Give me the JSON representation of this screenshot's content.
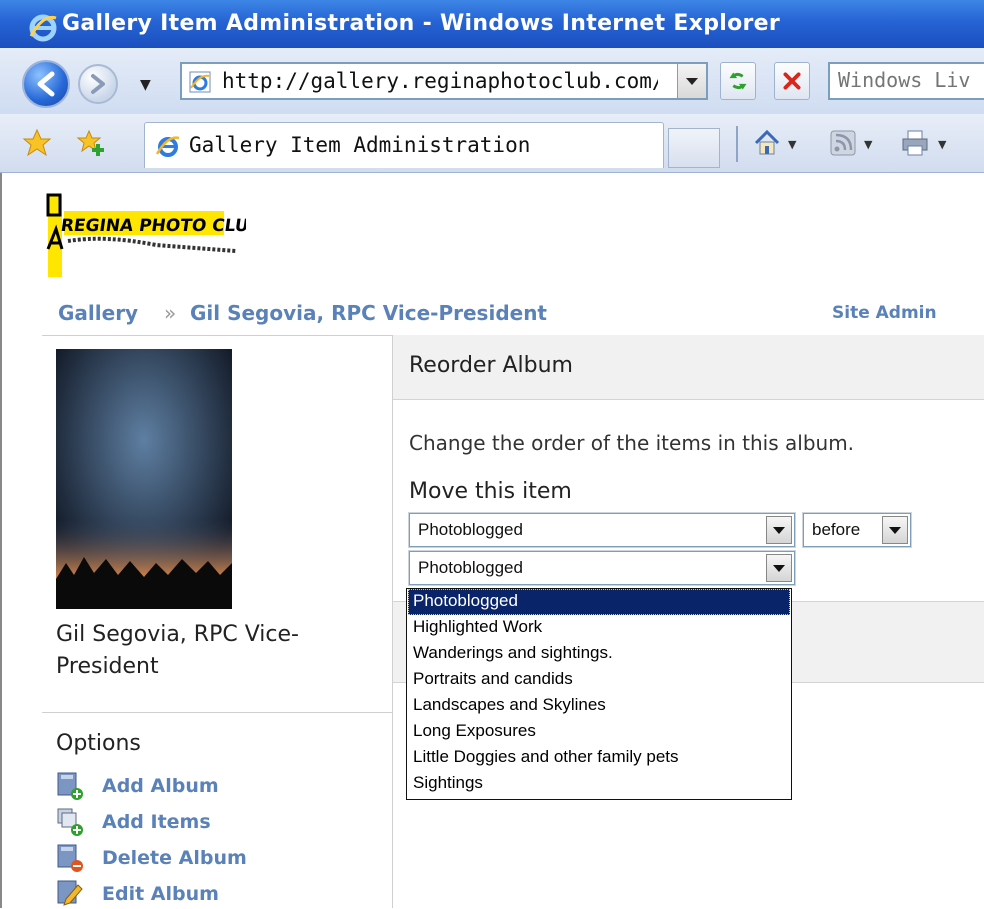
{
  "window": {
    "title": "Gallery Item Administration - Windows Internet Explorer"
  },
  "navbar": {
    "url": "http://gallery.reginaphotoclub.com/mai",
    "search_placeholder": "Windows Liv"
  },
  "tabbar": {
    "active_tab_title": "Gallery Item Administration"
  },
  "site": {
    "logo_alt": "REGINA PHOTO CLUB"
  },
  "breadcrumb": {
    "root": "Gallery",
    "separator": "»",
    "current": "Gil Segovia, RPC Vice-President",
    "site_admin": "Site Admin"
  },
  "sidebar": {
    "album_caption": "Gil Segovia, RPC Vice-President",
    "options_heading": "Options",
    "options": [
      {
        "label": "Add Album",
        "icon": "add-album-icon"
      },
      {
        "label": "Add Items",
        "icon": "add-items-icon"
      },
      {
        "label": "Delete Album",
        "icon": "delete-album-icon"
      },
      {
        "label": "Edit Album",
        "icon": "edit-album-icon"
      }
    ]
  },
  "content": {
    "title": "Reorder Album",
    "instructions": "Change the order of the items in this album.",
    "move_label": "Move this item",
    "item_select_value": "Photoblogged",
    "position_select_value": "before",
    "target_select_value": "Photoblogged",
    "dropdown_options": [
      "Photoblogged",
      "Highlighted Work",
      "Wanderings and sightings.",
      "Portraits and candids",
      "Landscapes and Skylines",
      "Long Exposures",
      "Little Doggies and other family pets",
      "Sightings"
    ],
    "dropdown_selected_index": 0
  },
  "colors": {
    "link": "#5a82b8",
    "titlebar": "#2663d4",
    "selection": "#0a246a"
  }
}
